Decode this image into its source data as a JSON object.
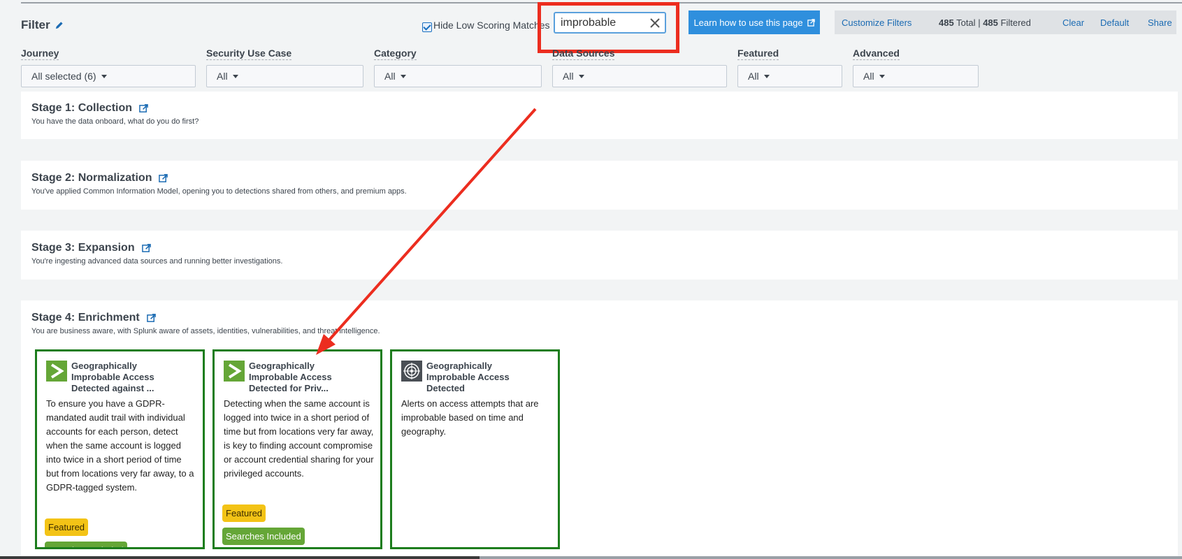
{
  "filter": {
    "title": "Filter",
    "hide_low_label": "Hide Low Scoring Matches",
    "hide_low_checked": true,
    "search_value": "improbable",
    "learn_button": "Learn how to use this page",
    "customize": "Customize Filters",
    "total_count": "485",
    "total_label": "Total",
    "separator": "|",
    "filtered_count": "485",
    "filtered_label": "Filtered",
    "clear": "Clear",
    "default": "Default",
    "share": "Share"
  },
  "dropdowns": [
    {
      "label": "Journey",
      "value": "All selected (6)"
    },
    {
      "label": "Security Use Case",
      "value": "All"
    },
    {
      "label": "Category",
      "value": "All"
    },
    {
      "label": "Data Sources",
      "value": "All"
    },
    {
      "label": "Featured",
      "value": "All"
    },
    {
      "label": "Advanced",
      "value": "All"
    }
  ],
  "stages": [
    {
      "title": "Stage 1: Collection",
      "desc": "You have the data onboard, what do you do first?"
    },
    {
      "title": "Stage 2: Normalization",
      "desc": "You've applied Common Information Model, opening you to detections shared from others, and premium apps."
    },
    {
      "title": "Stage 3: Expansion",
      "desc": "You're ingesting advanced data sources and running better investigations."
    },
    {
      "title": "Stage 4: Enrichment",
      "desc": "You are business aware, with Splunk aware of assets, identities, vulnerabilities, and threat intelligence."
    }
  ],
  "cards": [
    {
      "icon": "splunk-prompt-icon",
      "title_l1": "Geographically",
      "title_l2": "Improbable Access",
      "title_l3": "Detected against ...",
      "desc": "To ensure you have a GDPR-mandated audit trail with individual accounts for each person, detect when the same account is logged into twice in a short period of time but from locations very far away, to a GDPR-tagged system.",
      "badges": [
        "Featured",
        "Searches Included"
      ]
    },
    {
      "icon": "splunk-prompt-icon",
      "title_l1": "Geographically",
      "title_l2": "Improbable Access",
      "title_l3": "Detected for Priv...",
      "desc": "Detecting when the same account is logged into twice in a short period of time but from locations very far away, is key to finding account compromise or account credential sharing for your privileged accounts.",
      "badges": [
        "Featured",
        "Searches Included"
      ]
    },
    {
      "icon": "target-logo-icon",
      "title_l1": "Geographically",
      "title_l2": "Improbable Access",
      "title_l3": "Detected",
      "desc": "Alerts on access attempts that are improbable based on time and geography.",
      "badges": []
    }
  ],
  "colors": {
    "accent_blue": "#2f8fdd",
    "link_blue": "#1b6bb3",
    "annotation_red": "#ec2d1f",
    "card_border_green": "#1d7d1d",
    "featured_badge": "#f3c316",
    "searches_badge": "#65a637"
  }
}
